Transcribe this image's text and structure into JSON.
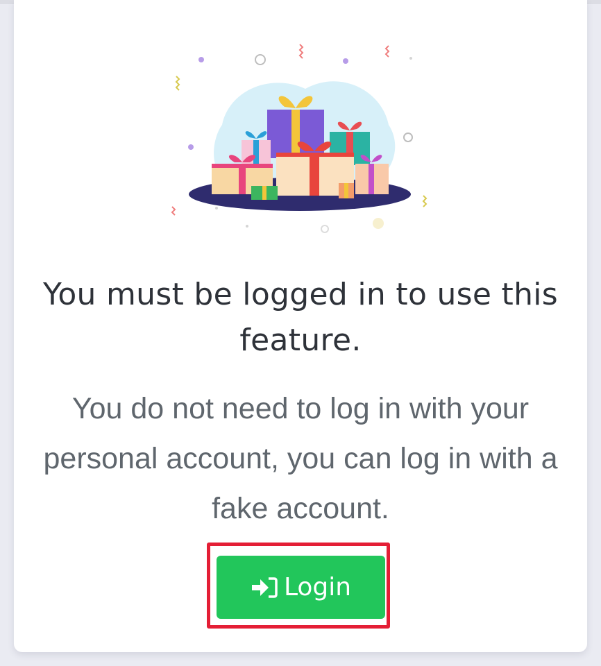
{
  "notice": {
    "heading": "You must be logged in to use this feature.",
    "description": "You do not need to log in with your personal account, you can log in with a fake account.",
    "illustration_icon": "gift-boxes-illustration"
  },
  "login_button": {
    "label": "Login",
    "icon": "sign-in-icon",
    "color": "#22c65b"
  },
  "highlight": {
    "color": "#e41e35"
  }
}
